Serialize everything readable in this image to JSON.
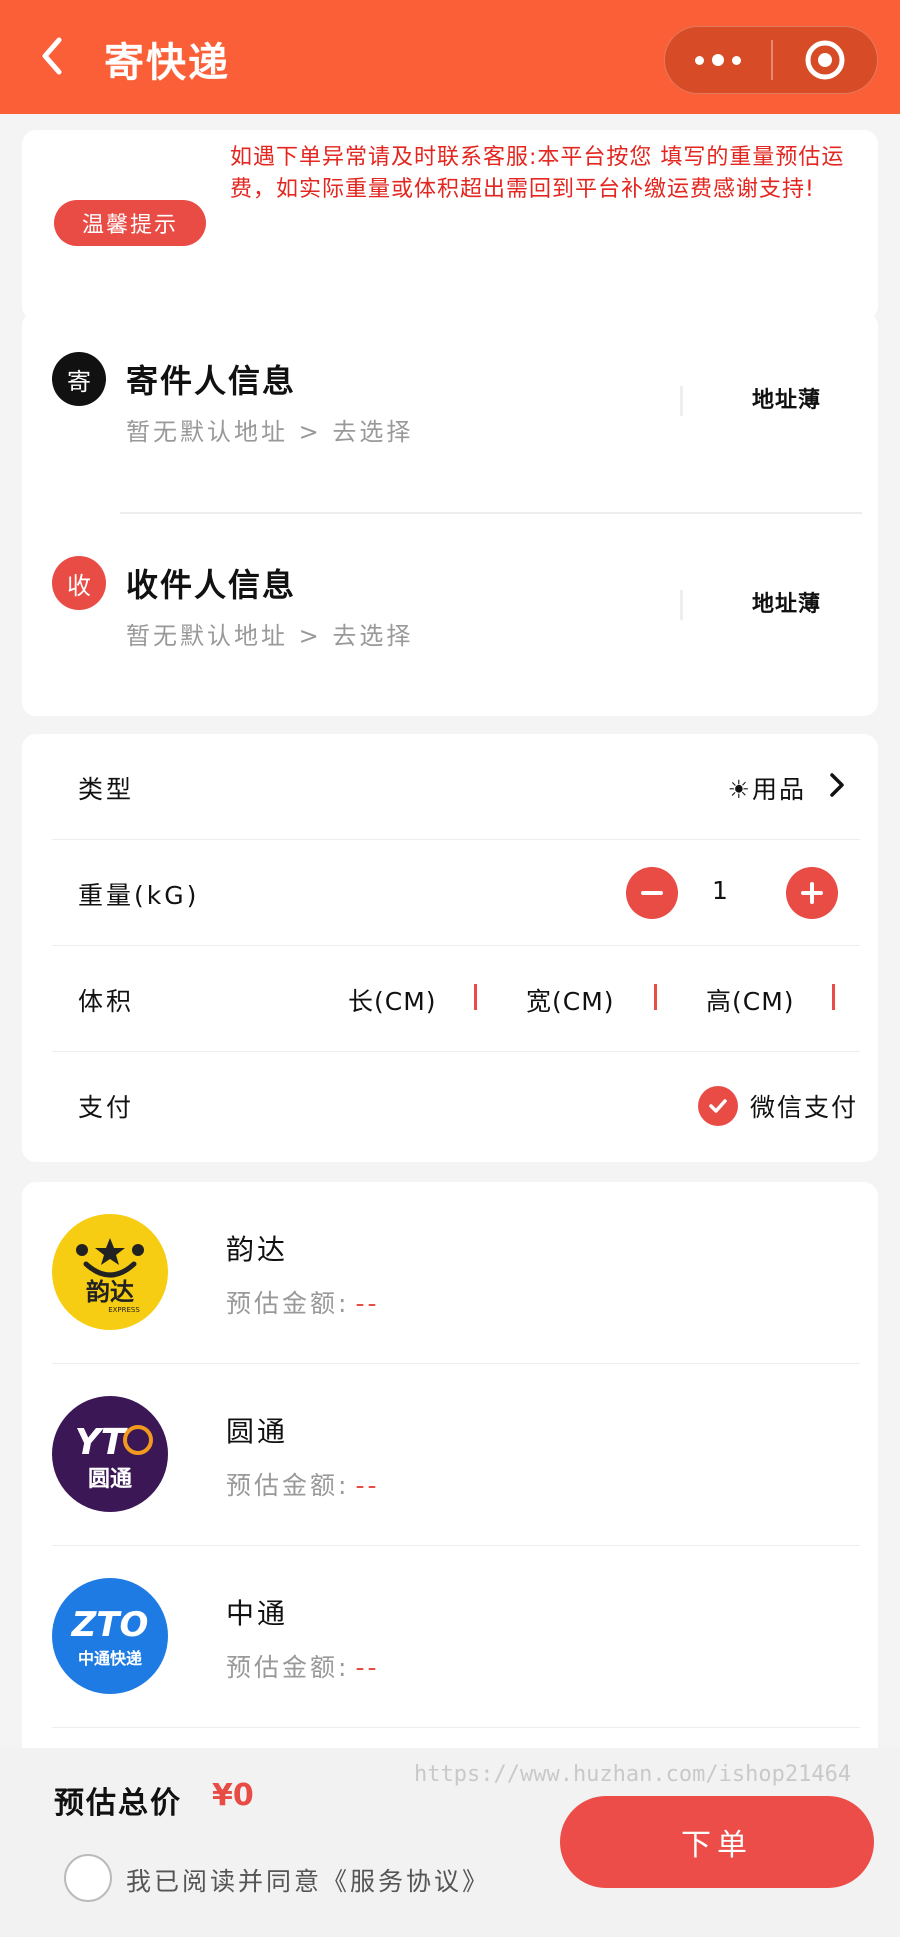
{
  "header": {
    "title": "寄快递",
    "back_icon": "chevron-left-icon",
    "more_icon": "more-dots-icon",
    "close_icon": "target-close-icon",
    "background_color": "#fb5f37"
  },
  "notice": {
    "badge": "温馨提示",
    "text": "如遇下单异常请及时联系客服:本平台按您 填写的重量预估运费，如实际重量或体积超出需回到平台补缴运费感谢支持!",
    "text_color": "#e3261f"
  },
  "sender": {
    "icon_text": "寄",
    "title": "寄件人信息",
    "subtitle": "暂无默认地址 > 去选择",
    "address_book": "地址薄"
  },
  "receiver": {
    "icon_text": "收",
    "title": "收件人信息",
    "subtitle": "暂无默认地址 > 去选择",
    "address_book": "地址薄"
  },
  "form": {
    "type_label": "类型",
    "type_value": "☀用品",
    "weight_label": "重量(kG)",
    "weight_value": "1",
    "volume_label": "体积",
    "length_label": "长(CM)",
    "width_label": "宽(CM)",
    "height_label": "高(CM)",
    "pay_label": "支付",
    "pay_method": "微信支付"
  },
  "couriers": [
    {
      "name": "韵达",
      "estimate_label": "预估金额:",
      "price": "--",
      "logo_text": "韵达",
      "logo_sub": "EXPRESS"
    },
    {
      "name": "圆通",
      "estimate_label": "预估金额:",
      "price": "--",
      "logo_text": "圆通",
      "logo_mark": "YT"
    },
    {
      "name": "中通",
      "estimate_label": "预估金额:",
      "price": "--",
      "logo_text": "中通快递",
      "logo_mark": "ZTO"
    }
  ],
  "bottom": {
    "total_label": "预估总价",
    "total_amount": "¥0",
    "watermark": "https://www.huzhan.com/ishop21464",
    "order_button": "下单",
    "agree_text": "我已阅读并同意《服务协议》"
  },
  "colors": {
    "accent_red": "#e94b45",
    "yunda_yellow": "#f7cd14",
    "yto_purple": "#3b1756",
    "zto_blue": "#1e7be4"
  }
}
